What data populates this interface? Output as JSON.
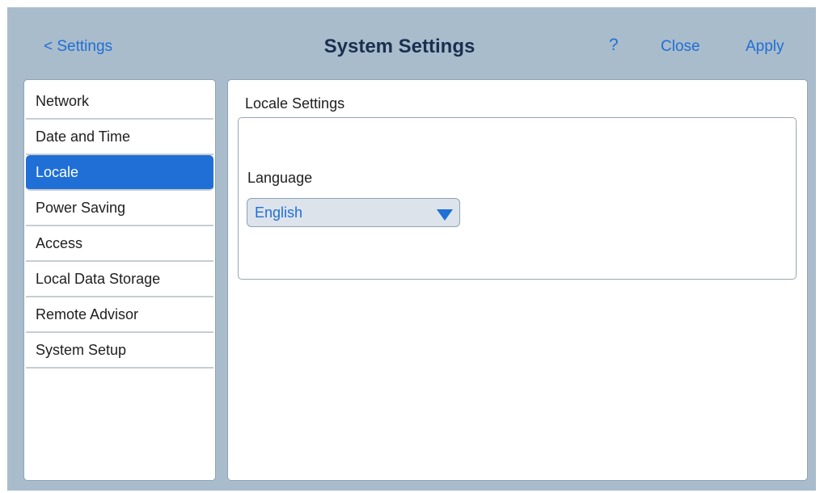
{
  "header": {
    "back_label": "< Settings",
    "title": "System Settings",
    "help_label": "?",
    "close_label": "Close",
    "apply_label": "Apply"
  },
  "sidebar": {
    "items": [
      {
        "label": "Network",
        "active": false
      },
      {
        "label": "Date and Time",
        "active": false
      },
      {
        "label": "Locale",
        "active": true
      },
      {
        "label": "Power Saving",
        "active": false
      },
      {
        "label": "Access",
        "active": false
      },
      {
        "label": "Local Data Storage",
        "active": false
      },
      {
        "label": "Remote Advisor",
        "active": false
      },
      {
        "label": "System Setup",
        "active": false
      }
    ]
  },
  "main": {
    "section_title": "Locale Settings",
    "language_label": "Language",
    "language_value": "English",
    "language_dropdown_icon": "triangle-down-icon"
  },
  "colors": {
    "accent": "#1f6fd6",
    "frame_background": "#a9bccb",
    "title_text": "#1a2f4f",
    "select_background": "#dde3ea"
  }
}
